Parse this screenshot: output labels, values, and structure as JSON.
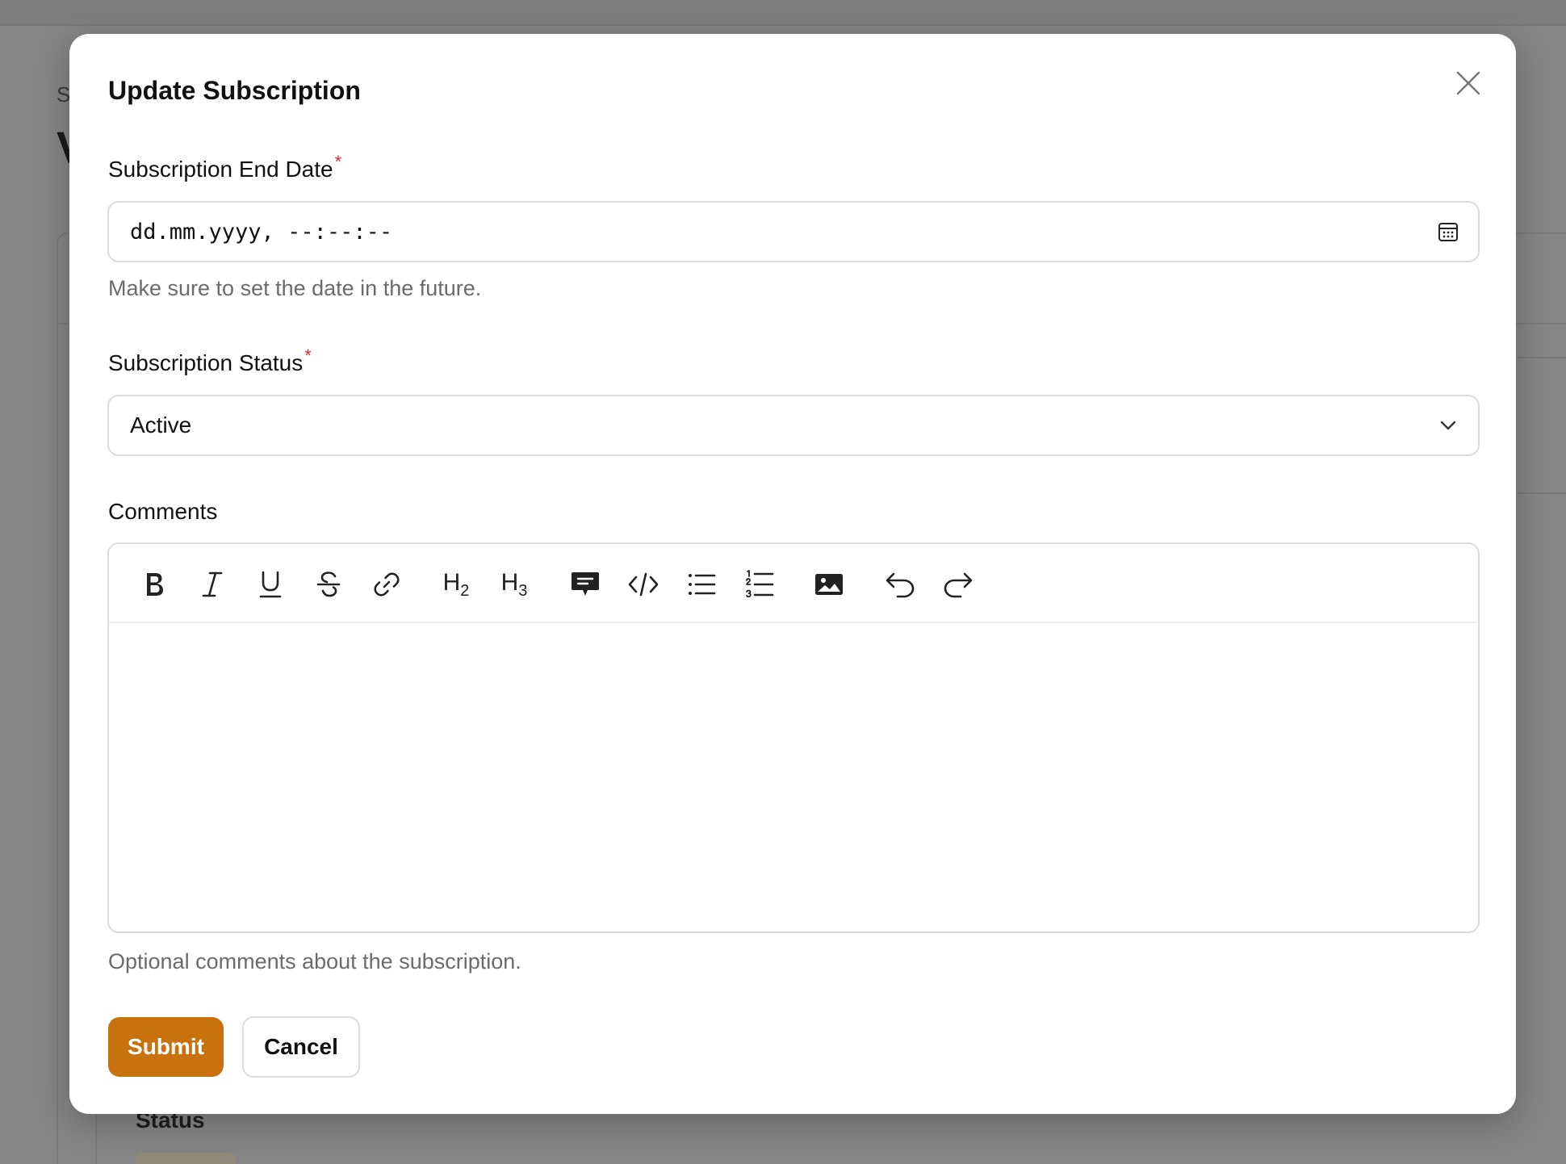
{
  "background": {
    "breadcrumb": "S",
    "title": "V",
    "status_label": "Status"
  },
  "modal": {
    "title": "Update Subscription",
    "close_icon": "close-icon",
    "end_date": {
      "label": "Subscription End Date",
      "required_mark": "*",
      "value": "dd.mm.yyyy, --:--:--",
      "icon": "calendar-icon",
      "hint": "Make sure to set the date in the future."
    },
    "status": {
      "label": "Subscription Status",
      "required_mark": "*",
      "selected": "Active",
      "icon": "chevron-down-icon"
    },
    "comments": {
      "label": "Comments",
      "hint": "Optional comments about the subscription.",
      "toolbar": {
        "h2": "H",
        "h2_sub": "2",
        "h3": "H",
        "h3_sub": "3",
        "icons": [
          "bold-icon",
          "italic-icon",
          "underline-icon",
          "strikethrough-icon",
          "link-icon",
          "heading-2-icon",
          "heading-3-icon",
          "blockquote-icon",
          "code-icon",
          "bullet-list-icon",
          "ordered-list-icon",
          "image-icon",
          "undo-icon",
          "redo-icon"
        ]
      }
    },
    "actions": {
      "submit": "Submit",
      "cancel": "Cancel"
    },
    "colors": {
      "primary": "#c7720f",
      "required": "#d62e2e",
      "overlay": "#858585"
    }
  }
}
